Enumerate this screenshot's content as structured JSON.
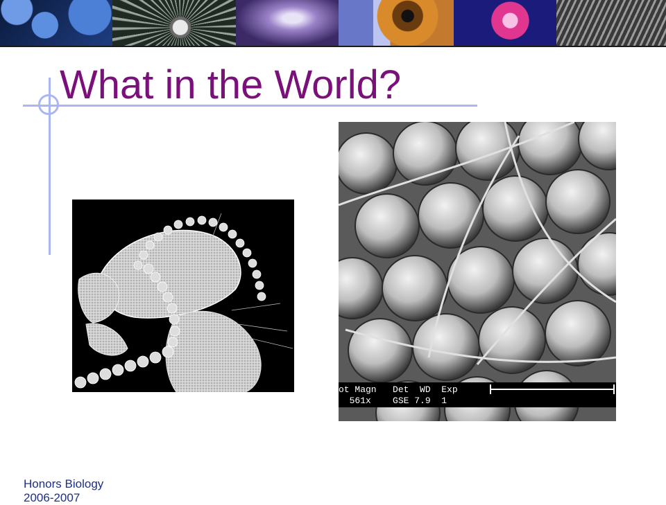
{
  "slide": {
    "title": "What in the World?",
    "footer": {
      "line1": "Honors Biology",
      "line2": "2006-2007"
    }
  },
  "sem_image": {
    "caption_row1": "ot Magn   Det  WD  Exp",
    "caption_row2": "  561x    GSE 7.9  1"
  },
  "colors": {
    "title": "#7a1079",
    "accent_lines": "#a9b6f2",
    "footer_text": "#1c2f8a"
  }
}
